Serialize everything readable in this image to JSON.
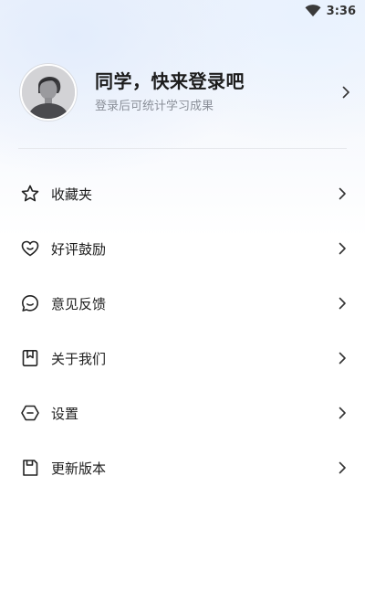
{
  "status_bar": {
    "time": "3:36",
    "icons": [
      "wifi-icon"
    ]
  },
  "profile": {
    "title": "同学，快来登录吧",
    "subtitle": "登录后可统计学习成果",
    "avatar": "avatar-image",
    "chevron_icon": "chevron-right-icon"
  },
  "menu": {
    "items": [
      {
        "label": "收藏夹",
        "icon": "star-icon"
      },
      {
        "label": "好评鼓励",
        "icon": "heart-icon"
      },
      {
        "label": "意见反馈",
        "icon": "chat-bubble-icon"
      },
      {
        "label": "关于我们",
        "icon": "bookmark-icon"
      },
      {
        "label": "设置",
        "icon": "settings-icon"
      },
      {
        "label": "更新版本",
        "icon": "save-icon"
      }
    ]
  },
  "colors": {
    "title_text": "#1c1c1c",
    "subtitle_text": "#8a8f98",
    "divider": "#e6e8ec",
    "background_tint": "#eef3fb"
  }
}
